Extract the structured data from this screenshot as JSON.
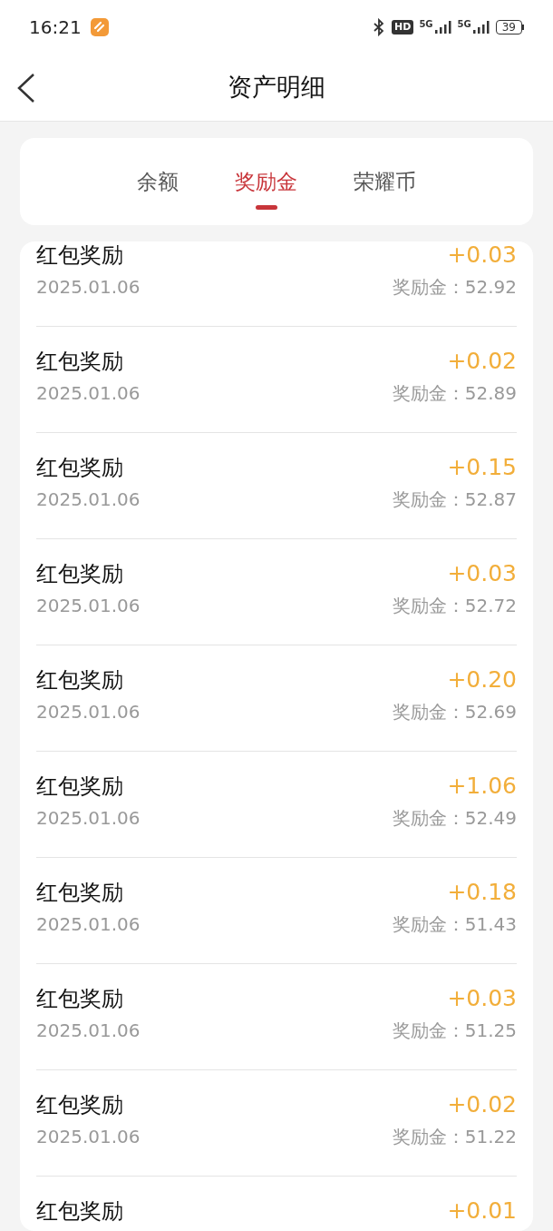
{
  "status_bar": {
    "time": "16:21",
    "hd_label": "HD",
    "network_labels": [
      "5G",
      "5G"
    ],
    "battery": "39"
  },
  "header": {
    "title": "资产明细"
  },
  "tabs": [
    {
      "label": "余额",
      "selected": false
    },
    {
      "label": "奖励金",
      "selected": true
    },
    {
      "label": "荣耀币",
      "selected": false
    }
  ],
  "records": [
    {
      "title": "红包奖励",
      "date": "2025.01.06",
      "amount": "+0.03",
      "balance": "奖励金：52.92"
    },
    {
      "title": "红包奖励",
      "date": "2025.01.06",
      "amount": "+0.02",
      "balance": "奖励金：52.89"
    },
    {
      "title": "红包奖励",
      "date": "2025.01.06",
      "amount": "+0.15",
      "balance": "奖励金：52.87"
    },
    {
      "title": "红包奖励",
      "date": "2025.01.06",
      "amount": "+0.03",
      "balance": "奖励金：52.72"
    },
    {
      "title": "红包奖励",
      "date": "2025.01.06",
      "amount": "+0.20",
      "balance": "奖励金：52.69"
    },
    {
      "title": "红包奖励",
      "date": "2025.01.06",
      "amount": "+1.06",
      "balance": "奖励金：52.49"
    },
    {
      "title": "红包奖励",
      "date": "2025.01.06",
      "amount": "+0.18",
      "balance": "奖励金：51.43"
    },
    {
      "title": "红包奖励",
      "date": "2025.01.06",
      "amount": "+0.03",
      "balance": "奖励金：51.25"
    },
    {
      "title": "红包奖励",
      "date": "2025.01.06",
      "amount": "+0.02",
      "balance": "奖励金：51.22"
    },
    {
      "title": "红包奖励",
      "amount": "+0.01"
    }
  ]
}
